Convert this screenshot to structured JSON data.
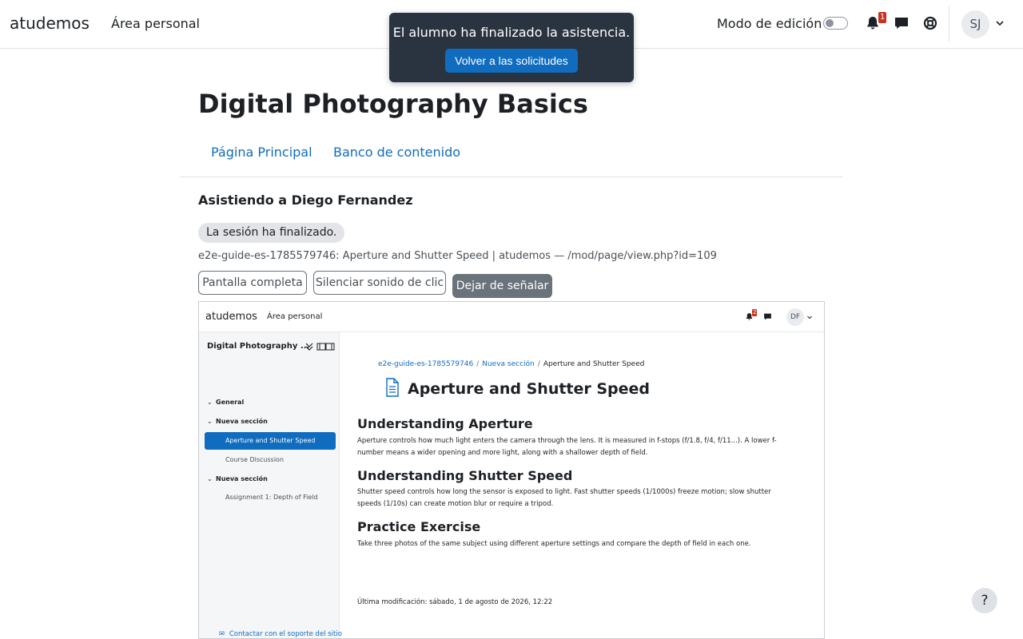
{
  "navbar": {
    "brand": "atudemos",
    "personal_area": "Área personal",
    "edit_mode_label": "Modo de edición",
    "notification_count": "1",
    "avatar_initials": "SJ"
  },
  "toast": {
    "message": "El alumno ha finalizado la asistencia.",
    "button_label": "Volver a las solicitudes"
  },
  "page": {
    "title": "Digital Photography Basics",
    "tabs": [
      {
        "label": "Página Principal"
      },
      {
        "label": "Banco de contenido"
      }
    ],
    "attending_heading": "Asistiendo a Diego Fernandez",
    "session_status": "La sesión ha finalizado.",
    "page_info": "e2e-guide-es-1785579746: Aperture and Shutter Speed | atudemos — /mod/page/view.php?id=109",
    "buttons": {
      "fullscreen": "Pantalla completa",
      "mute_click": "Silenciar sonido de clic",
      "stop_signal": "Dejar de señalar"
    }
  },
  "embedded": {
    "navbar": {
      "brand": "atudemos",
      "personal_area": "Área personal",
      "notification_count": "2",
      "avatar_initials": "DF"
    },
    "sidebar": {
      "course_title": "Digital Photography ...",
      "sections": [
        {
          "label": "General"
        },
        {
          "label": "Nueva sección"
        },
        {
          "label": "Nueva sección"
        }
      ],
      "items": [
        {
          "label": "Aperture and Shutter Speed"
        },
        {
          "label": "Course Discussion"
        },
        {
          "label": "Assignment 1: Depth of Field"
        }
      ]
    },
    "breadcrumb": {
      "course": "e2e-guide-es-1785579746",
      "section": "Nueva sección",
      "current": "Aperture and Shutter Speed"
    },
    "page_title": "Aperture and Shutter Speed",
    "content": {
      "h1": "Understanding Aperture",
      "p1": "Aperture controls how much light enters the camera through the lens. It is measured in f-stops (f/1.8, f/4, f/11...). A lower f-number means a wider opening and more light, along with a shallower depth of field.",
      "h2": "Understanding Shutter Speed",
      "p2": "Shutter speed controls how long the sensor is exposed to light. Fast shutter speeds (1/1000s) freeze motion; slow shutter speeds (1/10s) can create motion blur or require a tripod.",
      "h3": "Practice Exercise",
      "p3": "Take three photos of the same subject using different aperture settings and compare the depth of field in each one."
    },
    "last_modified": "Última modificación: sábado, 1 de agosto de 2026, 12:22",
    "support_link": "Contactar con el soporte del sitio"
  },
  "help_fab": "?",
  "colors": {
    "primary": "#0f6cbf",
    "toast_bg": "#2a3440",
    "badge": "#ca3120"
  }
}
